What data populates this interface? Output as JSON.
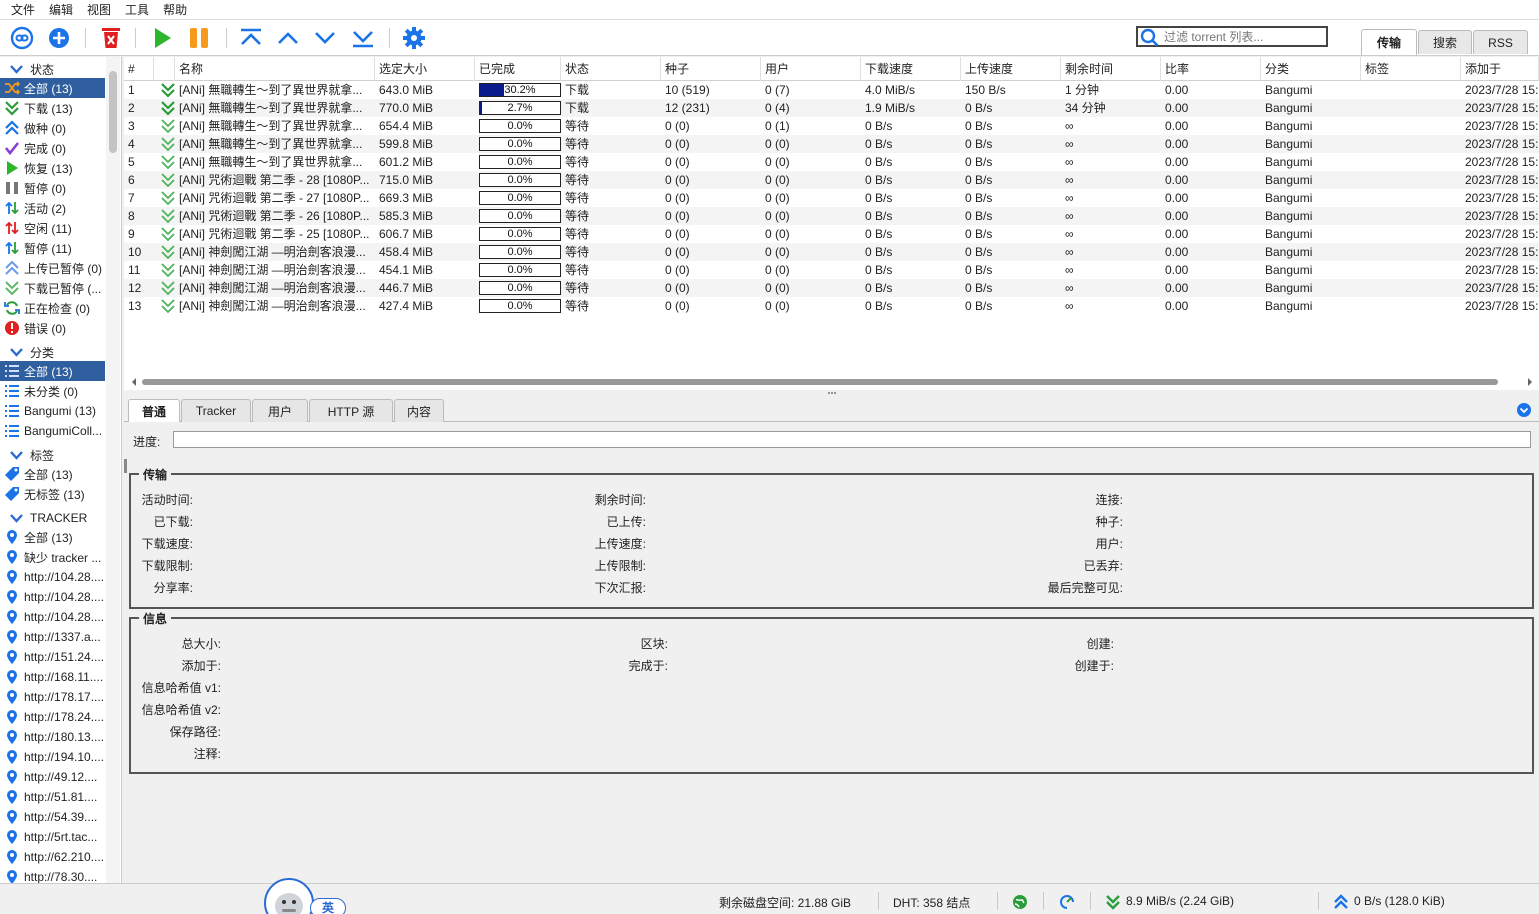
{
  "menu": [
    "文件",
    "编辑",
    "视图",
    "工具",
    "帮助"
  ],
  "toolbar": {
    "search_placeholder": "过滤 torrent 列表...",
    "tabs": [
      "传输",
      "搜索",
      "RSS"
    ]
  },
  "sidebar": {
    "status_header": "状态",
    "status_items": [
      {
        "label": "全部 (13)",
        "icon": "shuffle-icon"
      },
      {
        "label": "下载 (13)",
        "icon": "download-icon"
      },
      {
        "label": "做种 (0)",
        "icon": "upload-icon"
      },
      {
        "label": "完成 (0)",
        "icon": "checkmark-icon"
      },
      {
        "label": "恢复 (13)",
        "icon": "play-icon"
      },
      {
        "label": "暂停 (0)",
        "icon": "pause-icon"
      },
      {
        "label": "活动 (2)",
        "icon": "active-arrows-icon"
      },
      {
        "label": "空闲 (11)",
        "icon": "idle-arrows-icon"
      },
      {
        "label": "暂停 (11)",
        "icon": "stalled-arrows-icon"
      },
      {
        "label": "上传已暂停 (0)",
        "icon": "upload-paused-icon"
      },
      {
        "label": "下载已暂停 (...",
        "icon": "download-paused-icon"
      },
      {
        "label": "正在检查 (0)",
        "icon": "refresh-icon"
      },
      {
        "label": "错误 (0)",
        "icon": "error-icon"
      }
    ],
    "category_header": "分类",
    "category_items": [
      {
        "label": "全部 (13)"
      },
      {
        "label": "未分类 (0)"
      },
      {
        "label": "Bangumi (13)"
      },
      {
        "label": "BangumiColl..."
      }
    ],
    "tag_header": "标签",
    "tag_items": [
      {
        "label": "全部 (13)"
      },
      {
        "label": "无标签 (13)"
      }
    ],
    "tracker_header": "TRACKER",
    "tracker_items": [
      "全部 (13)",
      "缺少 tracker ...",
      "http://104.28....",
      "http://104.28....",
      "http://104.28....",
      "http://1337.a...",
      "http://151.24....",
      "http://168.11....",
      "http://178.17....",
      "http://178.24....",
      "http://180.13....",
      "http://194.10....",
      "http://49.12....",
      "http://51.81....",
      "http://54.39....",
      "http://5rt.tac...",
      "http://62.210....",
      "http://78.30...."
    ]
  },
  "table": {
    "columns": [
      "#",
      "",
      "名称",
      "选定大小",
      "已完成",
      "状态",
      "种子",
      "用户",
      "下载速度",
      "上传速度",
      "剩余时间",
      "比率",
      "分类",
      "标签",
      "添加于"
    ],
    "rows": [
      {
        "num": "1",
        "name": "[ANi] 無職轉生～到了異世界就拿...",
        "size": "643.0 MiB",
        "progress_label": "30.2%",
        "progress": 0.302,
        "state": "下载",
        "seeds": "10 (519)",
        "peers": "0 (7)",
        "dl": "4.0 MiB/s",
        "ul": "150 B/s",
        "eta": "1 分钟",
        "ratio": "0.00",
        "category": "Bangumi",
        "tags": "",
        "added": "2023/7/28 15:"
      },
      {
        "num": "2",
        "name": "[ANi] 無職轉生～到了異世界就拿...",
        "size": "770.0 MiB",
        "progress_label": "2.7%",
        "progress": 0.027,
        "state": "下载",
        "seeds": "12 (231)",
        "peers": "0 (4)",
        "dl": "1.9 MiB/s",
        "ul": "0 B/s",
        "eta": "34 分钟",
        "ratio": "0.00",
        "category": "Bangumi",
        "tags": "",
        "added": "2023/7/28 15:"
      },
      {
        "num": "3",
        "name": "[ANi] 無職轉生～到了異世界就拿...",
        "size": "654.4 MiB",
        "progress_label": "0.0%",
        "progress": 0,
        "state": "等待",
        "seeds": "0 (0)",
        "peers": "0 (1)",
        "dl": "0 B/s",
        "ul": "0 B/s",
        "eta": "∞",
        "ratio": "0.00",
        "category": "Bangumi",
        "tags": "",
        "added": "2023/7/28 15:"
      },
      {
        "num": "4",
        "name": "[ANi] 無職轉生～到了異世界就拿...",
        "size": "599.8 MiB",
        "progress_label": "0.0%",
        "progress": 0,
        "state": "等待",
        "seeds": "0 (0)",
        "peers": "0 (0)",
        "dl": "0 B/s",
        "ul": "0 B/s",
        "eta": "∞",
        "ratio": "0.00",
        "category": "Bangumi",
        "tags": "",
        "added": "2023/7/28 15:"
      },
      {
        "num": "5",
        "name": "[ANi] 無職轉生～到了異世界就拿...",
        "size": "601.2 MiB",
        "progress_label": "0.0%",
        "progress": 0,
        "state": "等待",
        "seeds": "0 (0)",
        "peers": "0 (0)",
        "dl": "0 B/s",
        "ul": "0 B/s",
        "eta": "∞",
        "ratio": "0.00",
        "category": "Bangumi",
        "tags": "",
        "added": "2023/7/28 15:"
      },
      {
        "num": "6",
        "name": "[ANi] 咒術迴戰 第二季 - 28 [1080P...",
        "size": "715.0 MiB",
        "progress_label": "0.0%",
        "progress": 0,
        "state": "等待",
        "seeds": "0 (0)",
        "peers": "0 (0)",
        "dl": "0 B/s",
        "ul": "0 B/s",
        "eta": "∞",
        "ratio": "0.00",
        "category": "Bangumi",
        "tags": "",
        "added": "2023/7/28 15:"
      },
      {
        "num": "7",
        "name": "[ANi] 咒術迴戰 第二季 - 27 [1080P...",
        "size": "669.3 MiB",
        "progress_label": "0.0%",
        "progress": 0,
        "state": "等待",
        "seeds": "0 (0)",
        "peers": "0 (0)",
        "dl": "0 B/s",
        "ul": "0 B/s",
        "eta": "∞",
        "ratio": "0.00",
        "category": "Bangumi",
        "tags": "",
        "added": "2023/7/28 15:"
      },
      {
        "num": "8",
        "name": "[ANi] 咒術迴戰 第二季 - 26 [1080P...",
        "size": "585.3 MiB",
        "progress_label": "0.0%",
        "progress": 0,
        "state": "等待",
        "seeds": "0 (0)",
        "peers": "0 (0)",
        "dl": "0 B/s",
        "ul": "0 B/s",
        "eta": "∞",
        "ratio": "0.00",
        "category": "Bangumi",
        "tags": "",
        "added": "2023/7/28 15:"
      },
      {
        "num": "9",
        "name": "[ANi] 咒術迴戰 第二季 - 25 [1080P...",
        "size": "606.7 MiB",
        "progress_label": "0.0%",
        "progress": 0,
        "state": "等待",
        "seeds": "0 (0)",
        "peers": "0 (0)",
        "dl": "0 B/s",
        "ul": "0 B/s",
        "eta": "∞",
        "ratio": "0.00",
        "category": "Bangumi",
        "tags": "",
        "added": "2023/7/28 15:"
      },
      {
        "num": "10",
        "name": "[ANi] 神劍闖江湖 —明治劍客浪漫...",
        "size": "458.4 MiB",
        "progress_label": "0.0%",
        "progress": 0,
        "state": "等待",
        "seeds": "0 (0)",
        "peers": "0 (0)",
        "dl": "0 B/s",
        "ul": "0 B/s",
        "eta": "∞",
        "ratio": "0.00",
        "category": "Bangumi",
        "tags": "",
        "added": "2023/7/28 15:"
      },
      {
        "num": "11",
        "name": "[ANi] 神劍闖江湖 —明治劍客浪漫...",
        "size": "454.1 MiB",
        "progress_label": "0.0%",
        "progress": 0,
        "state": "等待",
        "seeds": "0 (0)",
        "peers": "0 (0)",
        "dl": "0 B/s",
        "ul": "0 B/s",
        "eta": "∞",
        "ratio": "0.00",
        "category": "Bangumi",
        "tags": "",
        "added": "2023/7/28 15:"
      },
      {
        "num": "12",
        "name": "[ANi] 神劍闖江湖 —明治劍客浪漫...",
        "size": "446.7 MiB",
        "progress_label": "0.0%",
        "progress": 0,
        "state": "等待",
        "seeds": "0 (0)",
        "peers": "0 (0)",
        "dl": "0 B/s",
        "ul": "0 B/s",
        "eta": "∞",
        "ratio": "0.00",
        "category": "Bangumi",
        "tags": "",
        "added": "2023/7/28 15:"
      },
      {
        "num": "13",
        "name": "[ANi] 神劍闖江湖 —明治劍客浪漫...",
        "size": "427.4 MiB",
        "progress_label": "0.0%",
        "progress": 0,
        "state": "等待",
        "seeds": "0 (0)",
        "peers": "0 (0)",
        "dl": "0 B/s",
        "ul": "0 B/s",
        "eta": "∞",
        "ratio": "0.00",
        "category": "Bangumi",
        "tags": "",
        "added": "2023/7/28 15:"
      }
    ]
  },
  "detail": {
    "tabs": [
      "普通",
      "Tracker",
      "用户",
      "HTTP 源",
      "内容"
    ],
    "progress_label": "进度:",
    "transfer_title": "传输",
    "transfer_labels": [
      [
        "活动时间:",
        "剩余时间:",
        "连接:"
      ],
      [
        "已下载:",
        "已上传:",
        "种子:"
      ],
      [
        "下载速度:",
        "上传速度:",
        "用户:"
      ],
      [
        "下载限制:",
        "上传限制:",
        "已丢弃:"
      ],
      [
        "分享率:",
        "下次汇报:",
        "最后完整可见:"
      ]
    ],
    "info_title": "信息",
    "info_labels": [
      [
        "总大小:",
        "区块:",
        "创建:"
      ],
      [
        "添加于:",
        "完成于:",
        "创建于:"
      ],
      [
        "信息哈希值 v1:",
        "",
        ""
      ],
      [
        "信息哈希值 v2:",
        "",
        ""
      ],
      [
        "保存路径:",
        "",
        ""
      ],
      [
        "注释:",
        "",
        ""
      ]
    ]
  },
  "status": {
    "disk_free": "剩余磁盘空间: 21.88 GiB",
    "dht": "DHT: 358 结点",
    "download_speed": "8.9 MiB/s (2.24 GiB)",
    "upload_speed": "0 B/s (128.0 KiB)",
    "ime_label": "英"
  }
}
